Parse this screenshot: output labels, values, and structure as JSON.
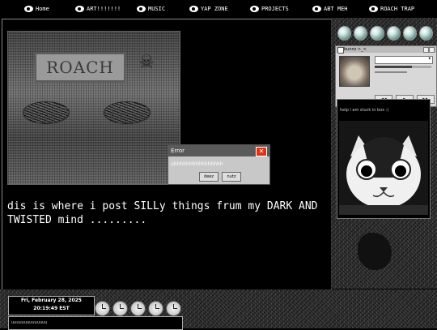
{
  "nav": {
    "items": [
      {
        "label": "Home"
      },
      {
        "label": "ART!!!!!!!"
      },
      {
        "label": "MUSIC"
      },
      {
        "label": "YAP ZONE"
      },
      {
        "label": "PROJECTS"
      },
      {
        "label": "ABT MEH"
      },
      {
        "label": "ROACH TRAP"
      }
    ]
  },
  "main": {
    "photo": {
      "sign_text": "ROACH"
    },
    "dialog": {
      "title": "Error",
      "close": "✕",
      "message": "uhhhhhhhhhhhhhhhh",
      "buttons": [
        {
          "label": "deez"
        },
        {
          "label": "nutz"
        }
      ]
    },
    "caption": "dis is where i post SILLy things frum my DARK AND TWISTED mind ........."
  },
  "sidebar": {
    "player": {
      "title": "bunnz >_<",
      "progress": 0.65,
      "buttons": [
        {
          "label": "◀◀"
        },
        {
          "label": "▶"
        },
        {
          "label": "▶▶"
        }
      ]
    },
    "box_text": "help i am stuck in box :("
  },
  "bottom": {
    "date": "Fri, February 28, 2025",
    "time": "20:19:49 EST",
    "chat": "uuuuuuuuuuuuuu"
  },
  "colors": {
    "background": "#000000",
    "dialog_close": "#dd3311"
  }
}
